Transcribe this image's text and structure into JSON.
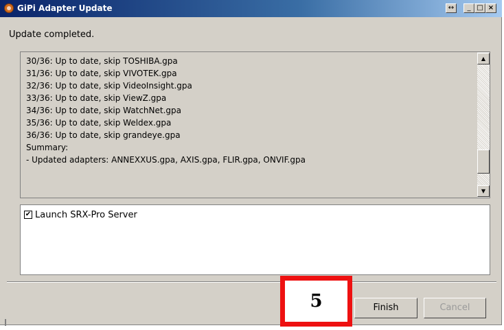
{
  "window": {
    "title": "GiPi Adapter Update",
    "controls": {
      "restore": "↔",
      "minimize": "_",
      "maximize": "□",
      "close": "×"
    }
  },
  "header": {
    "status": "Update completed."
  },
  "log": {
    "lines": [
      "30/36: Up to date, skip TOSHIBA.gpa",
      "31/36: Up to date, skip VIVOTEK.gpa",
      "32/36: Up to date, skip VideoInsight.gpa",
      "33/36: Up to date, skip ViewZ.gpa",
      "34/36: Up to date, skip WatchNet.gpa",
      "35/36: Up to date, skip Weldex.gpa",
      "36/36: Up to date, skip grandeye.gpa",
      "Summary:",
      "- Updated adapters: ANNEXXUS.gpa, AXIS.gpa, FLIR.gpa, ONVIF.gpa"
    ],
    "scroll_up_icon": "▲",
    "scroll_down_icon": "▼"
  },
  "options": {
    "launch_server_label": "Launch SRX-Pro Server",
    "launch_server_checked": true,
    "check_mark": "✔"
  },
  "buttons": {
    "finish": "Finish",
    "cancel": "Cancel"
  },
  "callout": {
    "label": "5",
    "color": "#ee1111"
  }
}
